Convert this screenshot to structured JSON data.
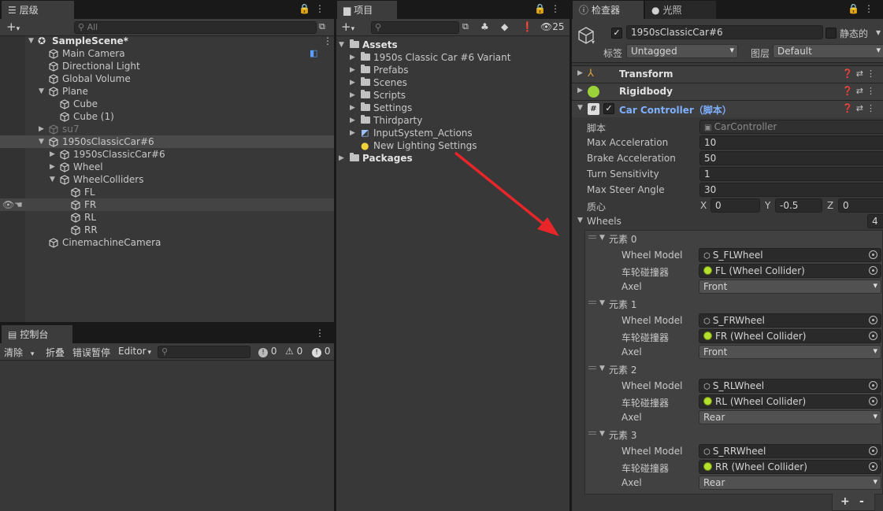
{
  "hierarchy": {
    "tab": "层级",
    "search_placeholder": "All",
    "scene": "SampleScene*",
    "items": [
      {
        "label": "Main Camera"
      },
      {
        "label": "Directional Light"
      },
      {
        "label": "Global Volume"
      },
      {
        "label": "Plane"
      },
      {
        "label": "Cube"
      },
      {
        "label": "Cube (1)"
      },
      {
        "label": "su7"
      },
      {
        "label": "1950sClassicCar#6"
      },
      {
        "label": "1950sClassicCar#6"
      },
      {
        "label": "Wheel"
      },
      {
        "label": "WheelColliders"
      },
      {
        "label": "FL"
      },
      {
        "label": "FR"
      },
      {
        "label": "RL"
      },
      {
        "label": "RR"
      },
      {
        "label": "CinemachineCamera"
      }
    ]
  },
  "console": {
    "tab": "控制台",
    "clear": "清除",
    "collapse": "折叠",
    "error_pause": "错误暂停",
    "editor": "Editor",
    "info_count": "0",
    "warn_count": "0",
    "error_count": "0"
  },
  "project": {
    "tab": "项目",
    "hidden_count": "25",
    "assets": "Assets",
    "folders": [
      {
        "label": "1950s Classic Car #6 Variant"
      },
      {
        "label": "Prefabs"
      },
      {
        "label": "Scenes"
      },
      {
        "label": "Scripts"
      },
      {
        "label": "Settings"
      },
      {
        "label": "Thirdparty"
      }
    ],
    "input_actions": "InputSystem_Actions",
    "lighting": "New Lighting Settings",
    "packages": "Packages"
  },
  "inspector": {
    "tab_inspector": "检查器",
    "tab_lighting": "光照",
    "object_name": "1950sClassicCar#6",
    "static_label": "静态的",
    "tag_label": "标签",
    "tag_value": "Untagged",
    "layer_label": "图层",
    "layer_value": "Default",
    "components": {
      "transform": "Transform",
      "rigidbody": "Rigidbody",
      "car_controller": "Car Controller（脚本）"
    },
    "script_label": "脚本",
    "script_value": "CarController",
    "props": [
      {
        "label": "Max Acceleration",
        "value": "10"
      },
      {
        "label": "Brake Acceleration",
        "value": "50"
      },
      {
        "label": "Turn Sensitivity",
        "value": "1"
      },
      {
        "label": "Max Steer Angle",
        "value": "30"
      }
    ],
    "com_label": "质心",
    "com": {
      "x": "0",
      "y": "-0.5",
      "z": "0",
      "xl": "X",
      "yl": "Y",
      "zl": "Z"
    },
    "wheels_label": "Wheels",
    "wheels_count": "4",
    "labels": {
      "wheel_model": "Wheel Model",
      "collider": "车轮碰撞器",
      "axel": "Axel"
    },
    "elements": [
      {
        "title": "元素 0",
        "model": "S_FLWheel",
        "collider": "FL (Wheel Collider)",
        "axel": "Front"
      },
      {
        "title": "元素 1",
        "model": "S_FRWheel",
        "collider": "FR (Wheel Collider)",
        "axel": "Front"
      },
      {
        "title": "元素 2",
        "model": "S_RLWheel",
        "collider": "RL (Wheel Collider)",
        "axel": "Rear"
      },
      {
        "title": "元素 3",
        "model": "S_RRWheel",
        "collider": "RR (Wheel Collider)",
        "axel": "Rear"
      }
    ],
    "add": "+",
    "remove": "-"
  },
  "colors": {
    "accent_link": "#7fb0ff",
    "annotation_arrow": "#e8262a",
    "wheel_collider": "#b6e02f"
  }
}
